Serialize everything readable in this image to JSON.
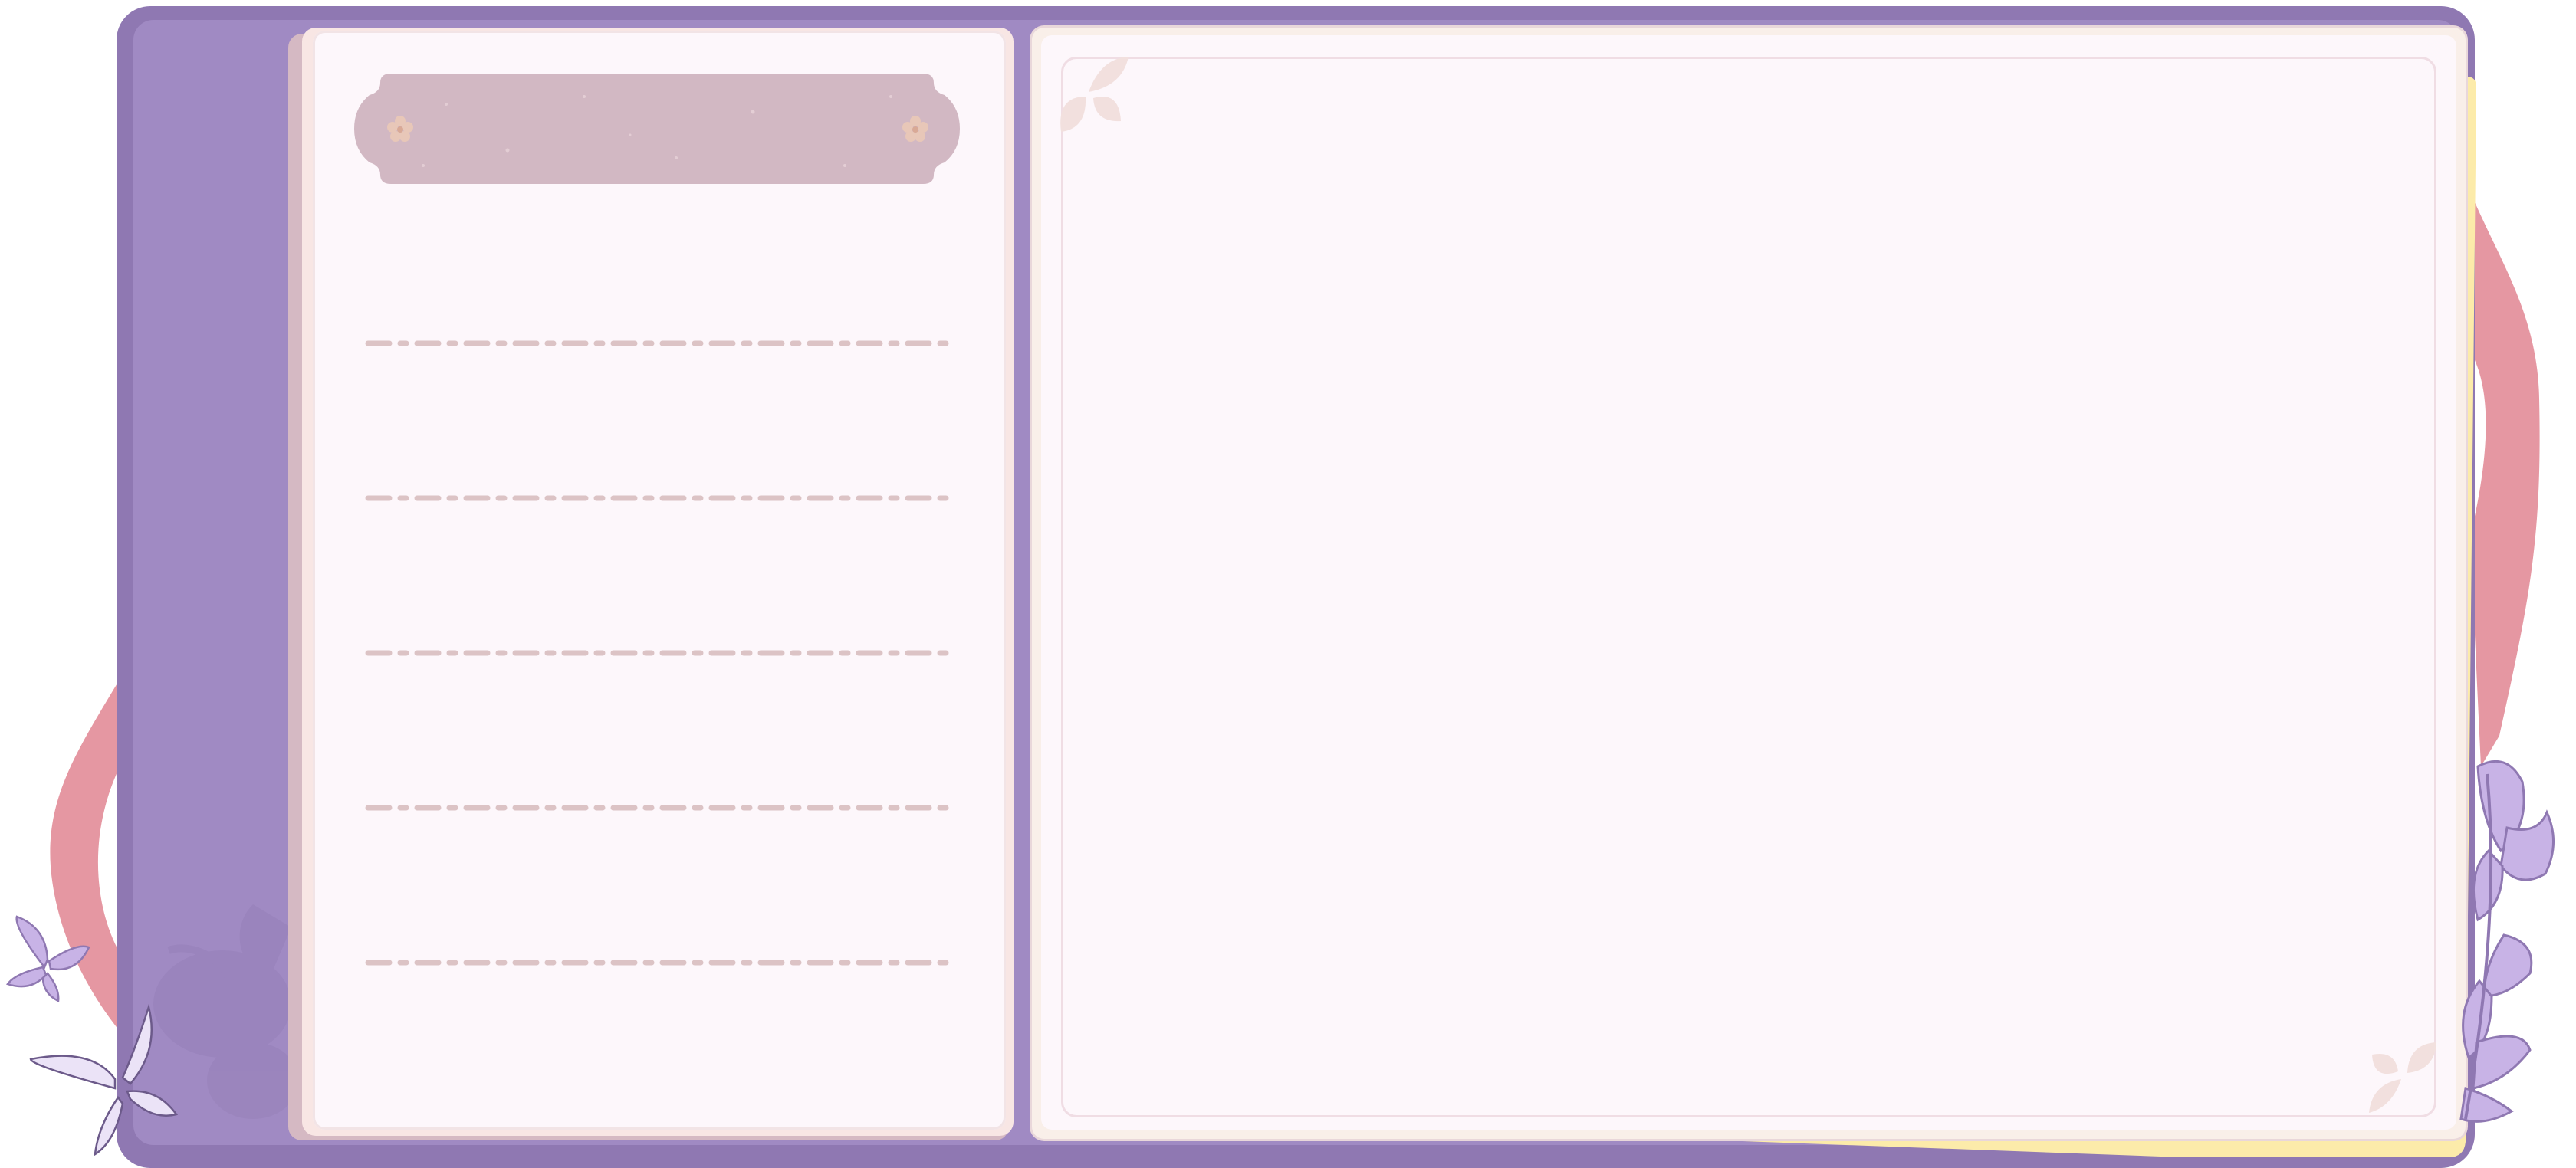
{
  "colors": {
    "binder": "#8f78b2",
    "binder_inner": "#a08ac3",
    "strap": "#e597a2",
    "paper": "#fdf7fb",
    "banner": "#d2b8c3",
    "dash": "#dcc3c5",
    "tab_yellow": "#fcebaa",
    "leaf": "#c8b3e6",
    "butterfly": "#ebe3f7"
  },
  "banner": {
    "title": "",
    "icon_left": "flower-icon",
    "icon_right": "flower-icon"
  },
  "list_entries": [
    "",
    "",
    "",
    "",
    ""
  ],
  "content": {
    "text": ""
  },
  "decorations": [
    "leaf-vine",
    "butterfly-large",
    "butterfly-small",
    "corner-petals"
  ]
}
